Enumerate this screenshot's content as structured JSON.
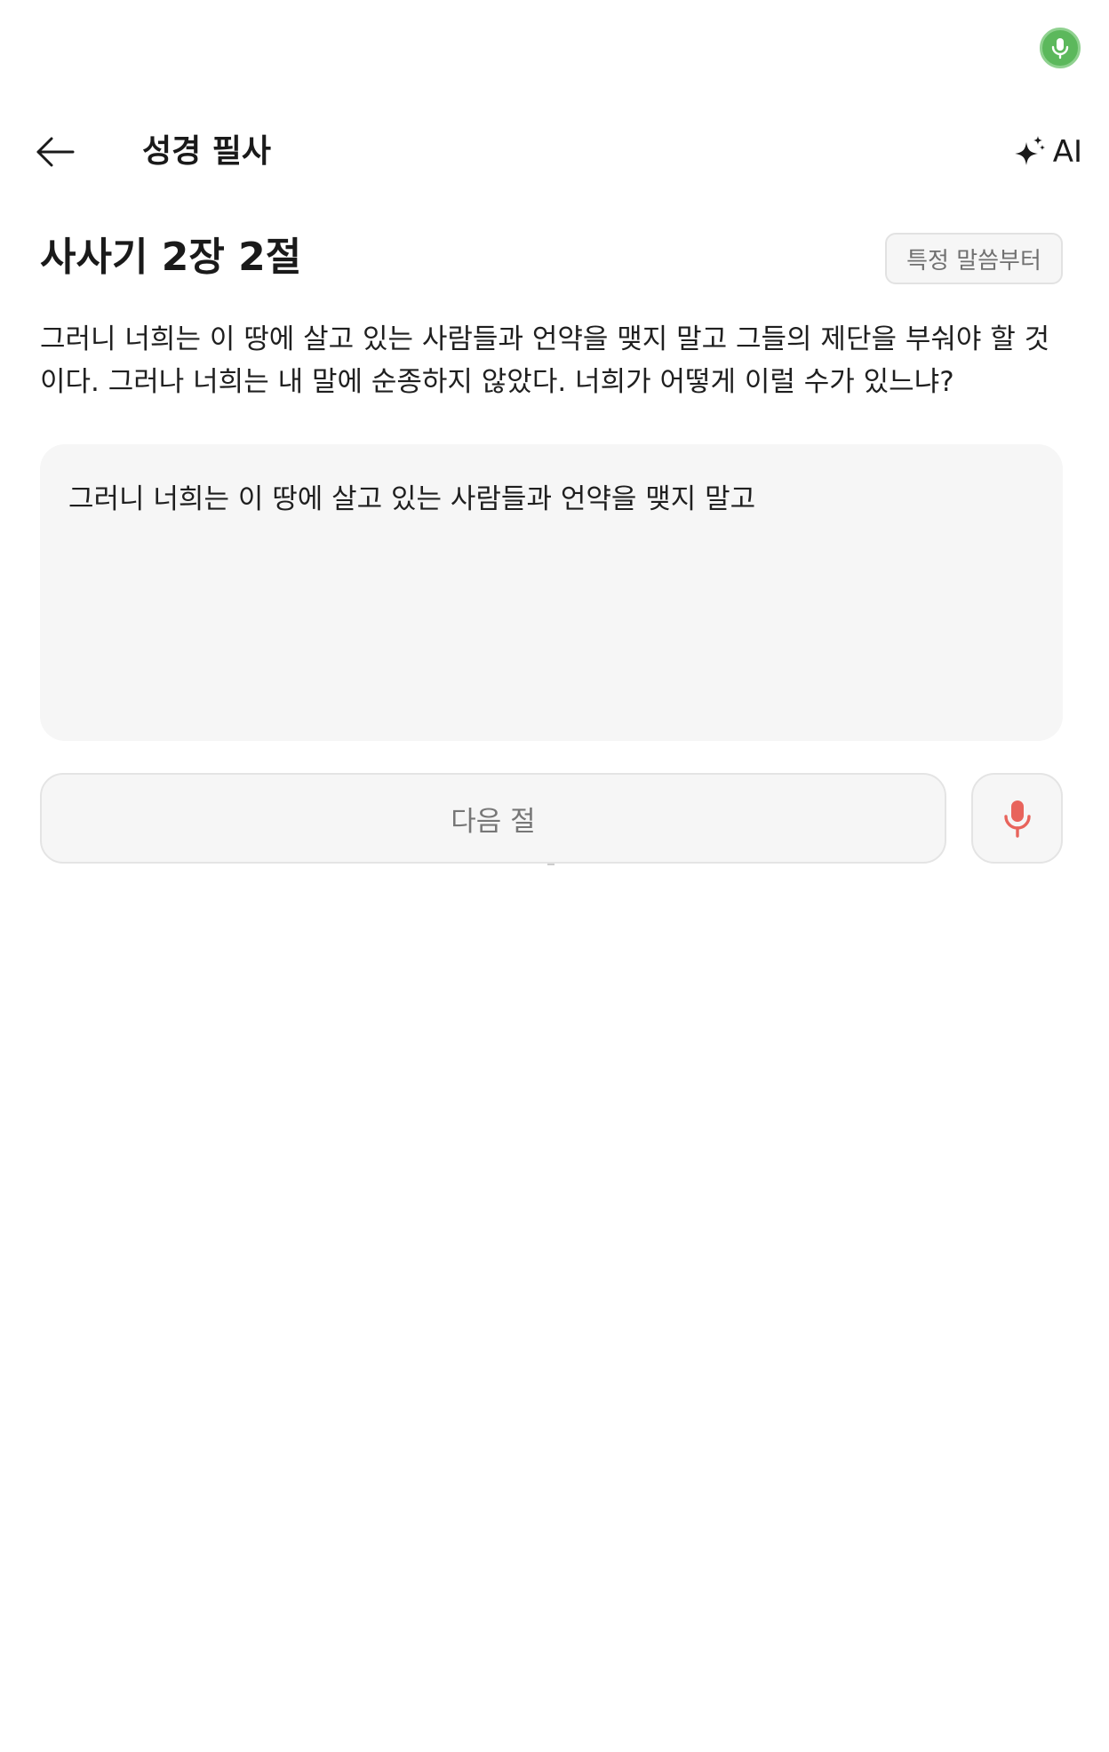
{
  "status_bar": {
    "mic_icon": "microphone-icon",
    "mic_color": "#5cb85c"
  },
  "header": {
    "back_icon": "arrow-left-icon",
    "title": "성경 필사",
    "ai_icon": "sparkle-icon",
    "ai_label": "AI"
  },
  "verse": {
    "heading": "사사기 2장 2절",
    "specific_button_label": "특정 말씀부터",
    "text": "그러니 너희는 이 땅에 살고 있는 사람들과 언약을 맺지 말고 그들의 제단을 부숴야 할 것이다. 그러나 너희는 내 말에 순종하지 않았다. 너희가 어떻게 이럴 수가 있느냐?"
  },
  "transcription": {
    "value": "그러니 너희는 이 땅에 살고 있는 사람들과 언약을 맺지 말고"
  },
  "actions": {
    "next_label": "다음 절",
    "mic_icon": "microphone-icon",
    "mic_color": "#e8645c"
  }
}
